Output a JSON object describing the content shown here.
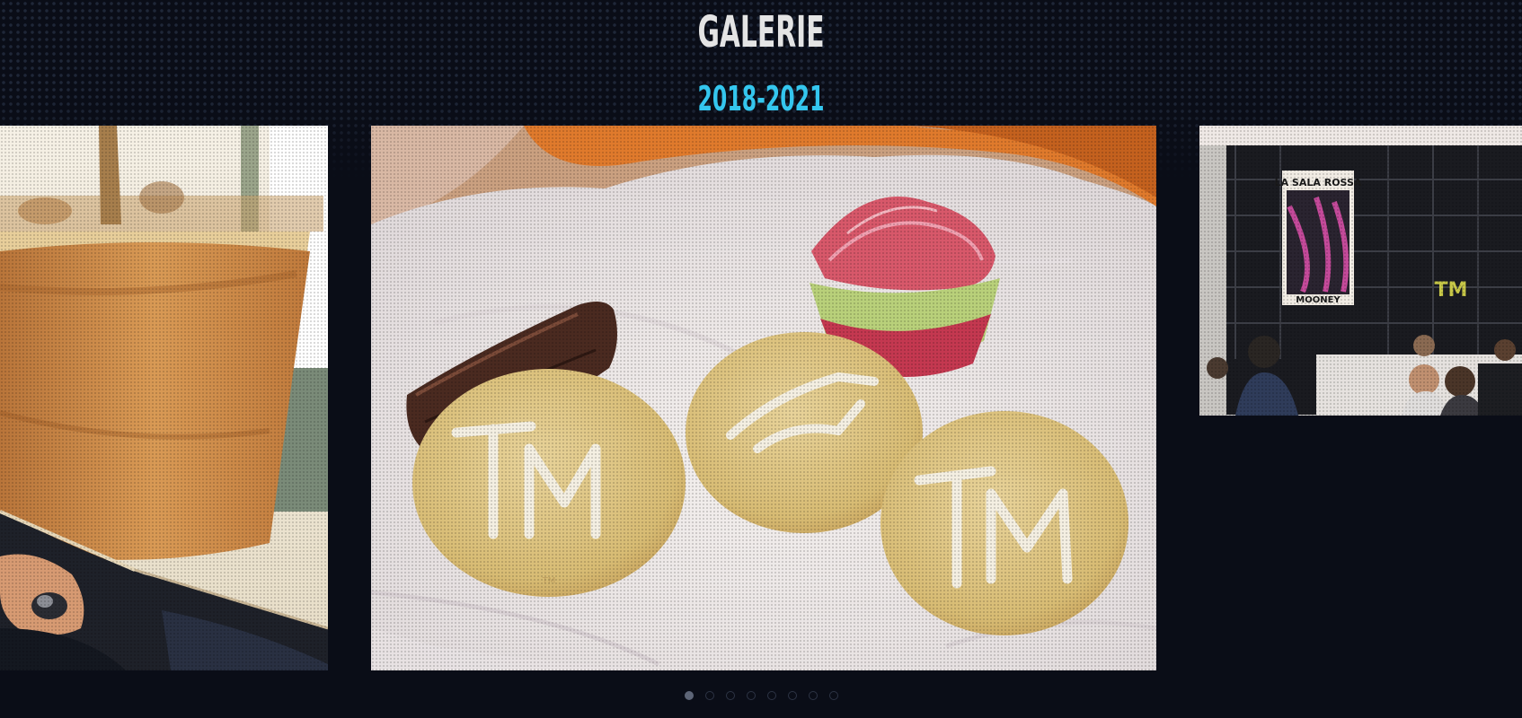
{
  "section": {
    "title": "GALERIE",
    "subtitle": "2018-2021"
  },
  "carousel": {
    "slides": [
      {
        "position": "previous",
        "subject": "person holding a plant pot"
      },
      {
        "position": "current",
        "subject": "TM cookies, brownie and cupcake on a napkin",
        "logo_text": "TM"
      },
      {
        "position": "next",
        "subject": "audience in a room with a poster",
        "poster_lines": [
          "LA SALA ROSSA",
          "MOONEY"
        ],
        "logo_text": "TM"
      }
    ],
    "dots_total": 8,
    "active_index": 0
  },
  "colors": {
    "background": "#0a0d17",
    "title": "#e4e4e4",
    "subtitle_accent": "#34c6ee",
    "dot_inactive": "#2d3445",
    "dot_active": "#5d6577"
  }
}
